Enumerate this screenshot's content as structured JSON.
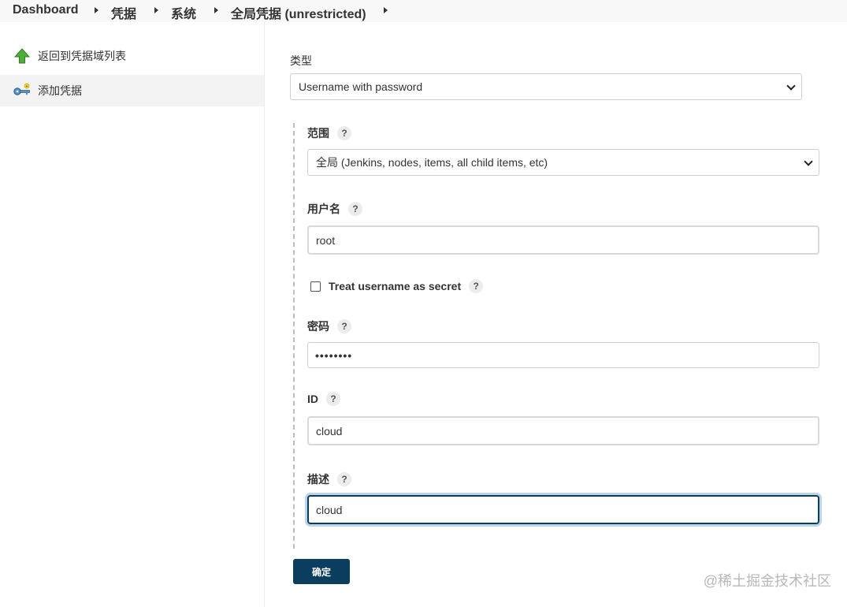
{
  "breadcrumb": {
    "items": [
      "Dashboard",
      "凭据",
      "系统",
      "全局凭据 (unrestricted)"
    ]
  },
  "sidebar": {
    "items": [
      {
        "label": "返回到凭据域列表",
        "icon": "up-arrow-icon"
      },
      {
        "label": "添加凭据",
        "icon": "key-icon"
      }
    ]
  },
  "form": {
    "kind_label": "类型",
    "kind_value": "Username with password",
    "scope_label": "范围",
    "scope_value": "全局 (Jenkins, nodes, items, all child items, etc)",
    "username_label": "用户名",
    "username_value": "root",
    "secret_checkbox_label": "Treat username as secret",
    "password_label": "密码",
    "password_value": "••••••••",
    "id_label": "ID",
    "id_value": "cloud",
    "description_label": "描述",
    "description_value": "cloud",
    "help_glyph": "?",
    "submit_label": "确定"
  },
  "watermark": "@稀土掘金技术社区",
  "colors": {
    "accent": "#0b3d5e",
    "focus_ring": "#bcd4e6",
    "arrow_green": "#4caf3a"
  }
}
